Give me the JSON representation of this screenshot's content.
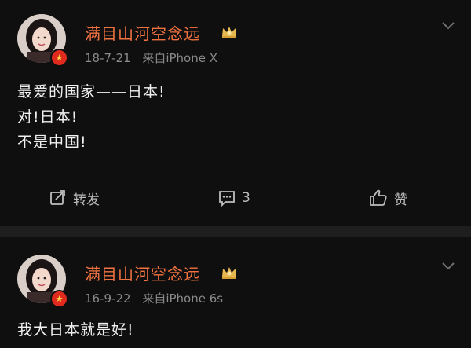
{
  "posts": [
    {
      "username": "满目山河空念远",
      "date": "18-7-21",
      "source": "来自iPhone X",
      "content_lines": [
        "最爱的国家——日本!",
        "对!日本!",
        "不是中国!"
      ],
      "actions": {
        "repost_label": "转发",
        "comment_count": "3",
        "like_label": "赞"
      }
    },
    {
      "username": "满目山河空念远",
      "date": "16-9-22",
      "source": "来自iPhone 6s",
      "content_lines": [
        "我大日本就是好!"
      ]
    }
  ],
  "colors": {
    "background": "#0f0f0f",
    "username": "#f2733f",
    "meta": "#8a8a8a",
    "verified_badge": "#e02a1e",
    "crown": "#e8b850"
  },
  "icons": {
    "repost": "repost-icon",
    "comment": "comment-icon",
    "like": "thumbs-up-icon",
    "more": "chevron-down-icon",
    "member": "crown-icon",
    "verified": "verified-badge-icon"
  }
}
